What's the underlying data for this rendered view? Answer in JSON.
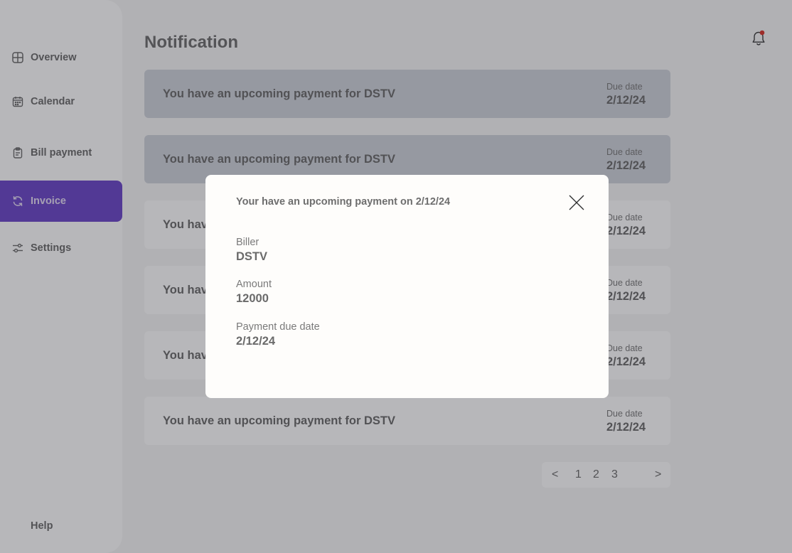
{
  "sidebar": {
    "items": [
      {
        "label": "Overview",
        "icon": "grid-icon"
      },
      {
        "label": "Calendar",
        "icon": "calendar-icon"
      },
      {
        "label": "Bill payment",
        "icon": "clipboard-icon"
      },
      {
        "label": "Invoice",
        "icon": "refresh-icon",
        "active": true
      },
      {
        "label": "Settings",
        "icon": "sliders-icon"
      }
    ],
    "help_label": "Help"
  },
  "header": {
    "title": "Notification",
    "notification_badge_color": "#d9342b"
  },
  "notifications": [
    {
      "message": "You have an upcoming payment for DSTV",
      "due_label": "Due date",
      "due_date": "2/12/24"
    },
    {
      "message": "You have an upcoming payment for DSTV",
      "due_label": "Due date",
      "due_date": "2/12/24"
    },
    {
      "message": "You hav",
      "due_label": "Due date",
      "due_date": "2/12/24"
    },
    {
      "message": "You hav",
      "due_label": "Due date",
      "due_date": "2/12/24"
    },
    {
      "message": "You hav",
      "due_label": "Due date",
      "due_date": "2/12/24"
    },
    {
      "message": "You have an upcoming payment for DSTV",
      "due_label": "Due date",
      "due_date": "2/12/24"
    }
  ],
  "pagination": {
    "prev": "<",
    "pages": [
      "1",
      "2",
      "3"
    ],
    "next": ">"
  },
  "modal": {
    "title": "Your have an upcoming payment on 2/12/24",
    "biller_label": "Biller",
    "biller_value": "DSTV",
    "amount_label": "Amount",
    "amount_value": "12000",
    "due_label": "Payment due date",
    "due_value": "2/12/24"
  },
  "colors": {
    "accent": "#6b46c9",
    "overlay": "rgba(30,30,40,0.32)"
  }
}
